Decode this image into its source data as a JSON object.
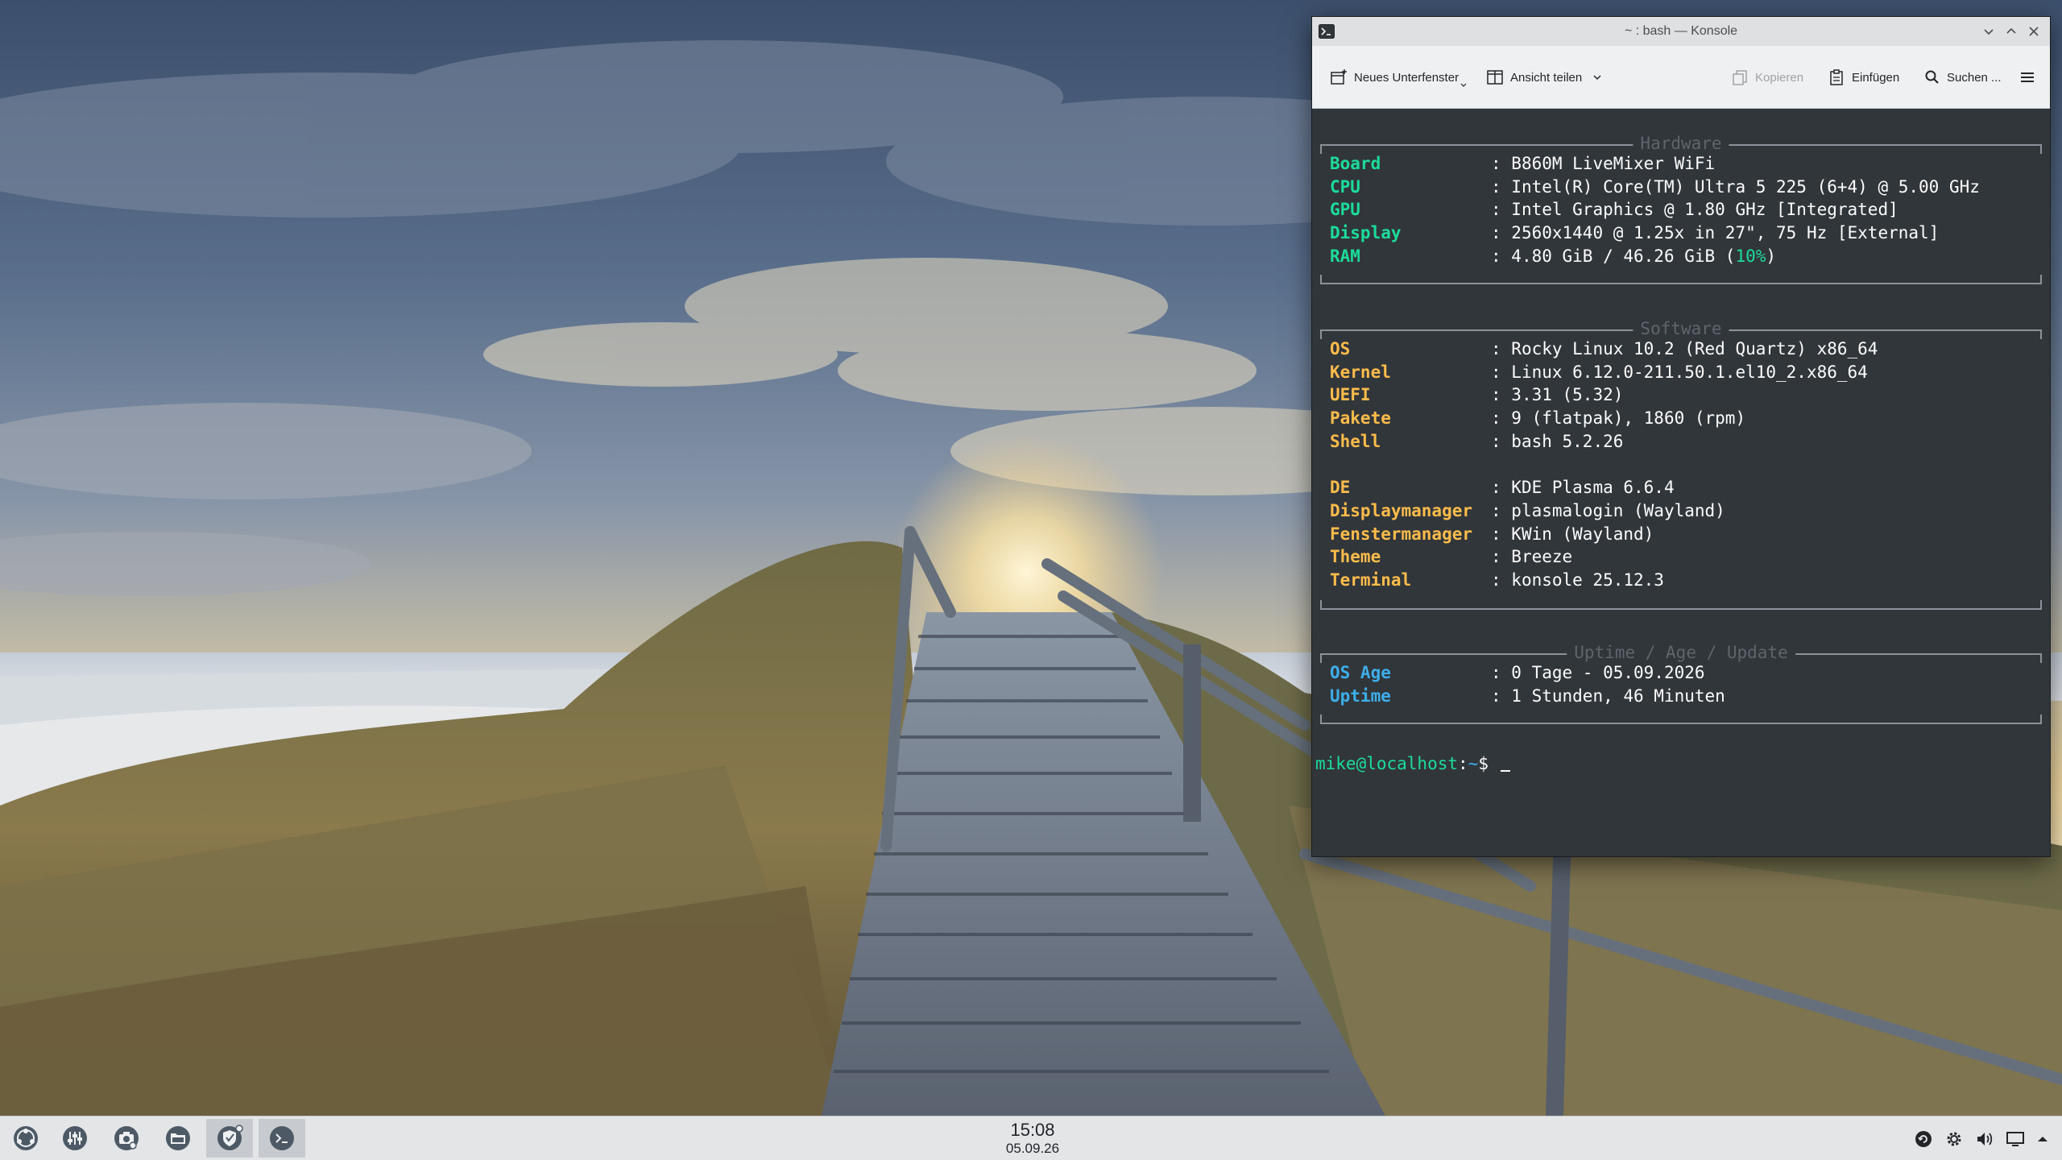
{
  "window": {
    "title": "~ : bash — Konsole",
    "toolbar": {
      "new_tab": "Neues Unterfenster",
      "split_view": "Ansicht teilen",
      "copy": "Kopieren",
      "paste": "Einfügen",
      "find": "Suchen ..."
    }
  },
  "terminal": {
    "sections": [
      {
        "title": "Hardware",
        "rows": [
          {
            "key": "Board",
            "value": "B860M LiveMixer WiFi"
          },
          {
            "key": "CPU",
            "value": "Intel(R) Core(TM) Ultra 5 225 (6+4) @ 5.00 GHz"
          },
          {
            "key": "GPU",
            "value": "Intel Graphics @ 1.80 GHz [Integrated]"
          },
          {
            "key": "Display",
            "value": "2560x1440 @ 1.25x in 27\", 75 Hz [External]"
          },
          {
            "key": "RAM",
            "value_prefix": "4.80 GiB / 46.26 GiB (",
            "value_pct": "10%",
            "value_suffix": ")"
          }
        ]
      },
      {
        "title": "Software",
        "rows": [
          {
            "key": "OS",
            "value": "Rocky Linux 10.2 (Red Quartz) x86_64"
          },
          {
            "key": "Kernel",
            "value": "Linux 6.12.0-211.50.1.el10_2.x86_64"
          },
          {
            "key": "UEFI",
            "value": "3.31 (5.32)"
          },
          {
            "key": "Pakete",
            "value": "9 (flatpak), 1860 (rpm)"
          },
          {
            "key": "Shell",
            "value": "bash 5.2.26"
          },
          {
            "key": "DE",
            "value": "KDE Plasma 6.6.4"
          },
          {
            "key": "Displaymanager",
            "value": "plasmalogin (Wayland)"
          },
          {
            "key": "Fenstermanager",
            "value": "KWin (Wayland)"
          },
          {
            "key": "Theme",
            "value": "Breeze"
          },
          {
            "key": "Terminal",
            "value": "konsole 25.12.3"
          }
        ]
      },
      {
        "title": "Uptime / Age / Update",
        "rows": [
          {
            "key": "OS Age",
            "value": "0 Tage - 05.09.2026"
          },
          {
            "key": "Uptime",
            "value": "1 Stunden, 46 Minuten"
          }
        ]
      }
    ],
    "prompt": {
      "user_host": "mike@localhost",
      "path": "~",
      "symbol": "$"
    }
  },
  "panel": {
    "clock": {
      "time": "15:08",
      "date": "05.09.26"
    },
    "tasks": [
      "app-launcher",
      "audio-mixer",
      "screenshot-tool",
      "file-manager",
      "security-app",
      "konsole"
    ]
  }
}
